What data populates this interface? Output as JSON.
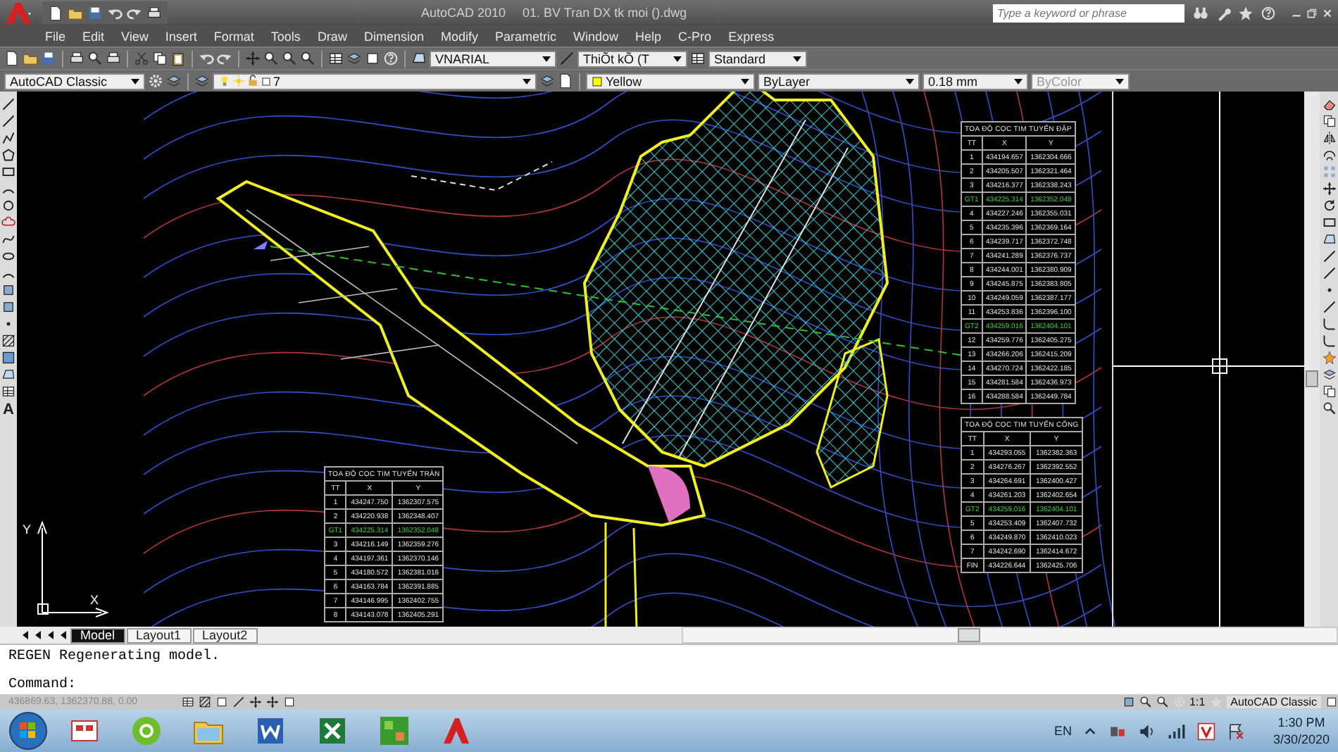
{
  "title_bar": {
    "app_title": "AutoCAD 2010",
    "file_name": "01. BV Tran DX tk moi ().dwg",
    "search": {
      "placeholder": "Type a keyword or phrase"
    }
  },
  "menu_bar": [
    "File",
    "Edit",
    "View",
    "Insert",
    "Format",
    "Tools",
    "Draw",
    "Dimension",
    "Modify",
    "Parametric",
    "Window",
    "Help",
    "C-Pro",
    "Express"
  ],
  "styles_toolbar": {
    "text_style": "VNARIAL",
    "dim_style": "ThiÕt kÕ (T",
    "table_style": "Standard"
  },
  "properties_toolbar": {
    "workspace": "AutoCAD Classic",
    "layer": "7",
    "color_setting": "Yellow",
    "linetype": "ByLayer",
    "lineweight": "0.18 mm",
    "plot_style": {
      "value": "ByColor",
      "disabled": true
    }
  },
  "left_toolbar": {
    "text_tool": "A"
  },
  "ucs_icon": {
    "x_label": "X",
    "y_label": "Y"
  },
  "tables": [
    {
      "title": "TOA ĐỘ CỌC TIM TUYẾN ĐẬP",
      "columns": [
        "TT",
        "X",
        "Y"
      ],
      "rows": [
        {
          "cells": [
            "1",
            "434194.657",
            "1362304.666"
          ],
          "highlighted": false
        },
        {
          "cells": [
            "2",
            "434205.507",
            "1362321.464"
          ],
          "highlighted": false
        },
        {
          "cells": [
            "3",
            "434216.377",
            "1362338.243"
          ],
          "highlighted": false
        },
        {
          "cells": [
            "GT1",
            "434225.314",
            "1362352.048"
          ],
          "highlighted": true
        },
        {
          "cells": [
            "4",
            "434227.246",
            "1362355.031"
          ],
          "highlighted": false
        },
        {
          "cells": [
            "5",
            "434235.396",
            "1362369.164"
          ],
          "highlighted": false
        },
        {
          "cells": [
            "6",
            "434239.717",
            "1362372.748"
          ],
          "highlighted": false
        },
        {
          "cells": [
            "7",
            "434241.289",
            "1362376.737"
          ],
          "highlighted": false
        },
        {
          "cells": [
            "8",
            "434244.001",
            "1362380.909"
          ],
          "highlighted": false
        },
        {
          "cells": [
            "9",
            "434245.875",
            "1362383.805"
          ],
          "highlighted": false
        },
        {
          "cells": [
            "10",
            "434249.059",
            "1362387.177"
          ],
          "highlighted": false
        },
        {
          "cells": [
            "11",
            "434253.836",
            "1362396.100"
          ],
          "highlighted": false
        },
        {
          "cells": [
            "GT2",
            "434259.016",
            "1362404.101"
          ],
          "highlighted": true
        },
        {
          "cells": [
            "12",
            "434259.776",
            "1362405.275"
          ],
          "highlighted": false
        },
        {
          "cells": [
            "13",
            "434266.206",
            "1362415.209"
          ],
          "highlighted": false
        },
        {
          "cells": [
            "14",
            "434270.724",
            "1362422.185"
          ],
          "highlighted": false
        },
        {
          "cells": [
            "15",
            "434281.584",
            "1362436.973"
          ],
          "highlighted": false
        },
        {
          "cells": [
            "16",
            "434288.584",
            "1362449.784"
          ],
          "highlighted": false
        }
      ]
    },
    {
      "title": "TOA ĐỘ CỌC TIM TUYẾN CỐNG",
      "columns": [
        "TT",
        "X",
        "Y"
      ],
      "rows": [
        {
          "cells": [
            "1",
            "434293.055",
            "1362382.363"
          ],
          "highlighted": false
        },
        {
          "cells": [
            "2",
            "434276.267",
            "1362392.552"
          ],
          "highlighted": false
        },
        {
          "cells": [
            "3",
            "434264.691",
            "1362400.427"
          ],
          "highlighted": false
        },
        {
          "cells": [
            "4",
            "434261.203",
            "1362402.654"
          ],
          "highlighted": false
        },
        {
          "cells": [
            "GT2",
            "434259.016",
            "1362404.101"
          ],
          "highlighted": true
        },
        {
          "cells": [
            "5",
            "434253.409",
            "1362407.732"
          ],
          "highlighted": false
        },
        {
          "cells": [
            "6",
            "434249.870",
            "1362410.023"
          ],
          "highlighted": false
        },
        {
          "cells": [
            "7",
            "434242.690",
            "1362414.672"
          ],
          "highlighted": false
        },
        {
          "cells": [
            "FIN",
            "434226.644",
            "1362425.706"
          ],
          "highlighted": false
        }
      ]
    },
    {
      "title": "TOA ĐỘ CỌC TIM TUYẾN TRÀN",
      "columns": [
        "TT",
        "X",
        "Y"
      ],
      "rows": [
        {
          "cells": [
            "1",
            "434247.750",
            "1362307.575"
          ],
          "highlighted": false
        },
        {
          "cells": [
            "2",
            "434220.938",
            "1362348.407"
          ],
          "highlighted": false
        },
        {
          "cells": [
            "GT1",
            "434225.314",
            "1362352.048"
          ],
          "highlighted": true
        },
        {
          "cells": [
            "3",
            "434216.149",
            "1362359.276"
          ],
          "highlighted": false
        },
        {
          "cells": [
            "4",
            "434197.361",
            "1362370.146"
          ],
          "highlighted": false
        },
        {
          "cells": [
            "5",
            "434180.572",
            "1362381.016"
          ],
          "highlighted": false
        },
        {
          "cells": [
            "6",
            "434163.784",
            "1362391.885"
          ],
          "highlighted": false
        },
        {
          "cells": [
            "7",
            "434146.995",
            "1362402.755"
          ],
          "highlighted": false
        },
        {
          "cells": [
            "8",
            "434143.078",
            "1362405.291"
          ],
          "highlighted": false
        }
      ]
    }
  ],
  "layout_tabs": [
    {
      "label": "Model",
      "selected": true
    },
    {
      "label": "Layout1",
      "selected": false
    },
    {
      "label": "Layout2",
      "selected": false
    }
  ],
  "command_history": [
    "REGEN Regenerating model."
  ],
  "command_prompt": "Command:",
  "status_bar": {
    "coordinates": "436869.63, 1362370.88, 0.00",
    "annotation_scale": "1:1",
    "workspace": "AutoCAD Classic"
  },
  "taskbar": {
    "language": "EN",
    "time": "1:30 PM",
    "date": "3/30/2020"
  }
}
